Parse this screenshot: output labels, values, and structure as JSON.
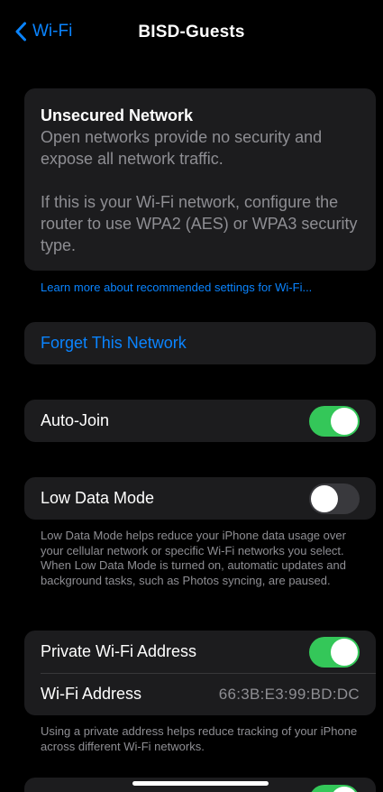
{
  "nav": {
    "back_label": "Wi-Fi",
    "title": "BISD-Guests"
  },
  "warning": {
    "title": "Unsecured Network",
    "text1": "Open networks provide no security and expose all network traffic.",
    "text2": "If this is your Wi-Fi network, configure the router to use WPA2 (AES) or WPA3 security type."
  },
  "learn_more_link": "Learn more about recommended settings for Wi-Fi...",
  "forget_label": "Forget This Network",
  "auto_join": {
    "label": "Auto-Join",
    "on": true
  },
  "low_data_mode": {
    "label": "Low Data Mode",
    "on": false,
    "footnote": "Low Data Mode helps reduce your iPhone data usage over your cellular network or specific Wi-Fi networks you select. When Low Data Mode is turned on, automatic updates and background tasks, such as Photos syncing, are paused."
  },
  "private_address": {
    "label": "Private Wi-Fi Address",
    "on": true,
    "address_label": "Wi-Fi Address",
    "address_value": "66:3B:E3:99:BD:DC",
    "footnote": "Using a private address helps reduce tracking of your iPhone across different Wi-Fi networks."
  },
  "colors": {
    "accent": "#0a84ff",
    "toggle_on": "#34c759",
    "toggle_off": "#39393d",
    "card": "#1c1c1e",
    "secondary_text": "#8e8e93"
  }
}
